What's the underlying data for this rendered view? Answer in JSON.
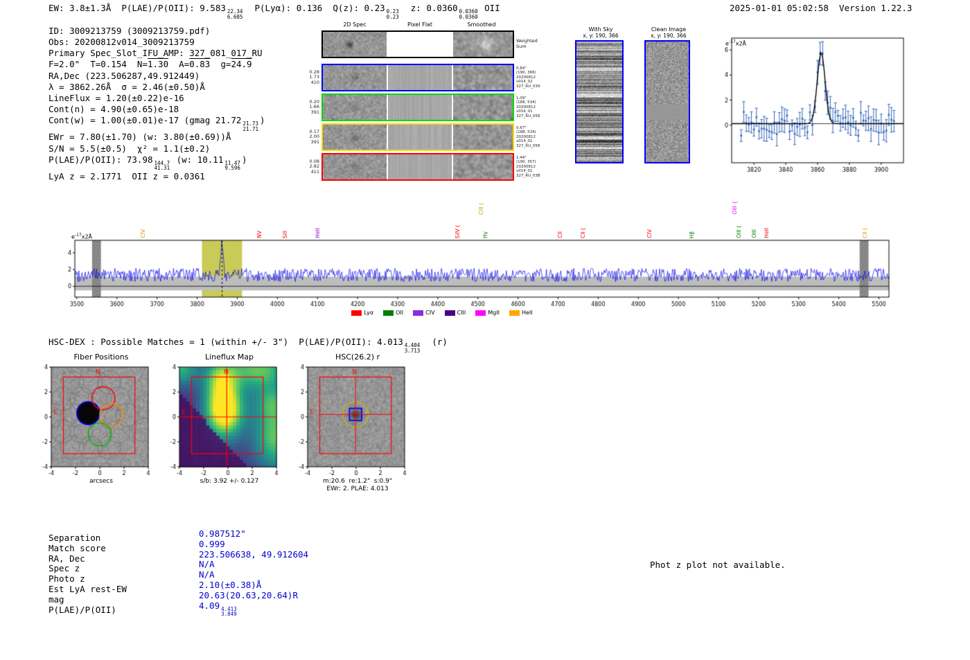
{
  "header": {
    "seg1": "EW: 3.8±1.3Å  P(LAE)/P(OII): 9.583",
    "stack1_sup": "22.34",
    "stack1_sub": "6.605",
    "seg2": "  P(Lyα): 0.136  Q(z): 0.23",
    "stack2_sup": "0.23",
    "stack2_sub": "0.23",
    "seg3": "  z: 0.0360",
    "stack3_sup": "0.0360",
    "stack3_sub": "0.0360",
    "seg4": " OII",
    "right": "2025-01-01 05:02:58  Version 1.22.3"
  },
  "info": {
    "l1": "ID: 3009213759 (3009213759.pdf)",
    "l2": "Obs: 20200812v014_3009213759",
    "l3": "Primary Spec_Slot_IFU_AMP: 327_081_017_RU",
    "l4a": "F=2.0\"  T=0.154  N=",
    "l4o1": "1.30",
    "l4b": "  A=",
    "l4o2": "0.83",
    "l4c": "  g=",
    "l4o3": "24.9",
    "l5": "RA,Dec (223.506287,49.912449)",
    "l6": "λ = 3862.26Å  σ = 2.46(±0.50)Å",
    "l7": "LineFlux = 1.20(±0.22)e-16",
    "l8": "Cont(n) = 4.90(±0.65)e-18",
    "l9a": "Cont(w) = 1.00(±0.01)e-17 (gmag 21.72",
    "l9sup": "21.73",
    "l9sub": "21.71",
    "l9b": ")",
    "l10": "EWr = 7.80(±1.70) (w: 3.80(±0.69))Å",
    "l11": "S/N = 5.5(±0.5)  χ² = 1.1(±0.2)",
    "l12a": "P(LAE)/P(OII): 73.98",
    "l12sup1": "144.7",
    "l12sub1": "41.31",
    "l12b": " (w: 10.11",
    "l12sup2": "11.47",
    "l12sub2": "9.596",
    "l12c": ")",
    "l13": "LyA z = 2.1771  OII z = 0.0361"
  },
  "spec2d": {
    "col_headers": [
      "2D Spec",
      "Pixel Flat",
      "Smoothed"
    ],
    "rows": [
      {
        "left": [],
        "right": [
          "Weighted",
          "Sum"
        ],
        "border": "#000000"
      },
      {
        "left": [
          "0.28",
          "1.73",
          "410"
        ],
        "right": [
          "0.84\"",
          "(190, 366)",
          "20200812",
          "v014_02",
          "327_RU_039"
        ],
        "border": "#0000ff"
      },
      {
        "left": [
          "0.20",
          "1.66",
          "391"
        ],
        "right": [
          "1.09\"",
          "(188, 534)",
          "20200812",
          "v014_01",
          "327_RU_058"
        ],
        "border": "#00dd00"
      },
      {
        "left": [
          "0.17",
          "2.00",
          "391"
        ],
        "right": [
          "0.67\"",
          "(188, 534)",
          "20200812",
          "v014_01",
          "327_RU_058"
        ],
        "border": "#ffd700"
      },
      {
        "left": [
          "0.08",
          "2.82",
          "411"
        ],
        "right": [
          "1.44\"",
          "(190, 357)",
          "20200812",
          "v014_01",
          "327_RU_03B"
        ],
        "border": "#ff0000"
      }
    ]
  },
  "sky_panels": {
    "with_sky": {
      "title": "With Sky",
      "subtitle": "x, y: 190, 366"
    },
    "clean": {
      "title": "Clean Image",
      "subtitle": "x, y: 190, 366"
    }
  },
  "hsc_line": {
    "prefix": "HSC-DEX : Possible Matches = 1 (within +/- 3\")  P(LAE)/P(OII): 4.013",
    "sup": "4.404",
    "sub": "3.713",
    "suffix": "  (r)"
  },
  "cutout_widgets": {
    "fiber": {
      "title": "Fiber Positions",
      "xlabel": "arcsecs"
    },
    "lineflux": {
      "title": "Lineflux Map",
      "caption": "s/b: 3.92 +/- 0.127"
    },
    "hsc": {
      "title": "HSC(26.2) r",
      "caption1": "m:20.6  re:1.2\"  s:0.9\"",
      "caption2": "EWr: 2. PLAE: 4.013"
    }
  },
  "match_table": {
    "rows": [
      {
        "label": "Separation",
        "value": "0.987512\""
      },
      {
        "label": "Match score",
        "value": "0.999"
      },
      {
        "label": "RA, Dec",
        "value": "223.506638, 49.912604"
      },
      {
        "label": "Spec z",
        "value": "N/A"
      },
      {
        "label": "Photo z",
        "value": "N/A"
      },
      {
        "label": "Est LyA rest-EW",
        "value": "2.10(±0.38)Å"
      },
      {
        "label": "mag",
        "value": "20.63(20.63,20.64)R"
      },
      {
        "label": "P(LAE)/P(OII)",
        "value": "4.09",
        "sup": "4.413",
        "sub": "3.849"
      }
    ]
  },
  "photz_note": "Phot z plot not available.",
  "chart_data": [
    {
      "id": "line_fit",
      "type": "scatter",
      "title": "",
      "unit_label": {
        "prefix": "e",
        "exp": "-17",
        "suffix": "x2Å"
      },
      "xlim": [
        3806,
        3914
      ],
      "x_ticks": [
        3820,
        3840,
        3860,
        3880,
        3900
      ],
      "ylim": [
        -3.0,
        6.95
      ],
      "y_ticks": [
        0,
        2,
        4,
        6
      ],
      "fit": {
        "center": 3862.26,
        "sigma": 2.46,
        "amplitude": 5.7,
        "continuum": 0.12
      },
      "noise": {
        "amplitude": 0.75,
        "seed": 7,
        "point_step": 1.6,
        "err_mean": 0.62
      },
      "point_color": "#3366bb",
      "fit_color": "#000000"
    },
    {
      "id": "full_spectrum",
      "type": "line",
      "title": "",
      "unit_label": {
        "prefix": "e",
        "exp": "-17",
        "suffix": "x2Å"
      },
      "xlim": [
        3495,
        5525
      ],
      "x_ticks": [
        3500,
        3600,
        3700,
        3800,
        3900,
        4000,
        4100,
        4200,
        4300,
        4400,
        4500,
        4600,
        4700,
        4800,
        4900,
        5000,
        5100,
        5200,
        5300,
        5400,
        5500
      ],
      "ylim": [
        -1.3,
        5.5
      ],
      "y_ticks": [
        0,
        2,
        4
      ],
      "continuum": 1.35,
      "noise_amplitude": 0.8,
      "seed": 99,
      "emission_line": {
        "center": 3862.26,
        "amplitude": 3.8,
        "sigma": 3.0
      },
      "error_band": {
        "low": -0.5,
        "high": 1.15,
        "color": "#bdbdbd"
      },
      "highlight_band": {
        "x0": 3812,
        "x1": 3912,
        "color": "rgba(184,184,30,0.75)"
      },
      "masked_bands": [
        {
          "x0": 3538,
          "x1": 3560
        },
        {
          "x0": 5452,
          "x1": 5474
        }
      ],
      "dashed_line_x": 3862.26,
      "line_color": "#0000ee",
      "line_labels": [
        {
          "text": "CIV",
          "x": 3665,
          "color": "#e69500",
          "lvl": 0
        },
        {
          "text": "NV",
          "x": 3955,
          "color": "#ff0000",
          "lvl": 0
        },
        {
          "text": "SiII",
          "x": 4018,
          "color": "#ff0000",
          "lvl": 0
        },
        {
          "text": "HeII",
          "x": 4100,
          "color": "#9400d3",
          "lvl": 0
        },
        {
          "text": "SiIV (",
          "x": 4448,
          "color": "#ff0000",
          "lvl": 0
        },
        {
          "text": "CIII (",
          "x": 4508,
          "color": "#c8a000",
          "lvl": 1
        },
        {
          "text": "Hγ",
          "x": 4518,
          "color": "#008000",
          "lvl": 0
        },
        {
          "text": "CII",
          "x": 4705,
          "color": "#ff0000",
          "lvl": 0
        },
        {
          "text": "CII (",
          "x": 4762,
          "color": "#ff0000",
          "lvl": 0
        },
        {
          "text": "CIV",
          "x": 4928,
          "color": "#ff0000",
          "lvl": 0
        },
        {
          "text": "Hβ",
          "x": 5032,
          "color": "#008000",
          "lvl": 0
        },
        {
          "text": "OIII {",
          "x": 5140,
          "color": "#ff00ff",
          "lvl": 1
        },
        {
          "text": "OIII (",
          "x": 5150,
          "color": "#008000",
          "lvl": 0
        },
        {
          "text": "OIII",
          "x": 5188,
          "color": "#008000",
          "lvl": 0
        },
        {
          "text": "HeII",
          "x": 5220,
          "color": "#ff0000",
          "lvl": 0
        },
        {
          "text": "CII (",
          "x": 5465,
          "color": "#e69500",
          "lvl": 0
        }
      ],
      "legend": [
        {
          "label": "Lyα",
          "color": "#ff0000"
        },
        {
          "label": "OII",
          "color": "#008000"
        },
        {
          "label": "CIV",
          "color": "#8a2be2"
        },
        {
          "label": "CIII",
          "color": "#4b0082"
        },
        {
          "label": "MgII",
          "color": "#ff00ff"
        },
        {
          "label": "HeII",
          "color": "#ffa500"
        }
      ]
    },
    {
      "id": "cutouts",
      "type": "image",
      "axis_range": [
        -4,
        4
      ],
      "ticks": [
        -4,
        -2,
        0,
        2,
        4
      ],
      "compass": {
        "n": "N",
        "e": "E"
      },
      "square": {
        "x0": -3.0,
        "y0": -2.95,
        "x1": 2.9,
        "y1": 3.2,
        "color": "#ff0000"
      },
      "fiber": {
        "circle_radius": 0.95,
        "gray_circles": [
          [
            0.76,
            0.15
          ],
          [
            -2.26,
            0.15
          ],
          [
            0.01,
            1.46
          ],
          [
            -1.51,
            1.46
          ],
          [
            0.01,
            -1.16
          ],
          [
            -1.51,
            -1.16
          ],
          [
            2.27,
            0.15
          ],
          [
            -3.77,
            0.15
          ],
          [
            1.52,
            1.46
          ],
          [
            -3.02,
            1.46
          ],
          [
            1.52,
            -1.16
          ],
          [
            -3.02,
            -1.16
          ],
          [
            0.76,
            2.77
          ],
          [
            -0.75,
            2.77
          ],
          [
            -2.26,
            2.77
          ],
          [
            0.76,
            -2.47
          ],
          [
            -0.75,
            -2.47
          ],
          [
            -2.26,
            -2.47
          ],
          [
            3.78,
            0.85
          ],
          [
            3.6,
            -1.05
          ]
        ],
        "colored_circles": [
          {
            "x": -0.95,
            "y": 0.3,
            "color": "#0000ff",
            "fill": "#05050a"
          },
          {
            "x": 0.3,
            "y": 1.5,
            "color": "#ff0000"
          },
          {
            "x": 0.95,
            "y": 0.15,
            "color": "#ff8c00"
          },
          {
            "x": 0.0,
            "y": -1.4,
            "color": "#00bb00"
          }
        ]
      },
      "lineflux": {
        "blobs": [
          {
            "x": -0.3,
            "y": 0.5,
            "sx": 1.1,
            "sy": 1.5,
            "amp": 1.05
          },
          {
            "x": -0.6,
            "y": 3.2,
            "sx": 1.0,
            "sy": 1.2,
            "amp": 0.55
          },
          {
            "x": 2.6,
            "y": 3.8,
            "sx": 1.7,
            "sy": 1.1,
            "amp": 0.6
          },
          {
            "x": 3.9,
            "y": -1.6,
            "sx": 1.3,
            "sy": 1.9,
            "amp": 0.6
          },
          {
            "x": -3.9,
            "y": 3.9,
            "sx": 1.0,
            "sy": 1.0,
            "amp": 0.5
          },
          {
            "x": 3.6,
            "y": 1.2,
            "sx": 1.0,
            "sy": 1.0,
            "amp": 0.35
          }
        ],
        "dark_edge": {
          "slope": -1.05,
          "intercept": -2.3
        }
      },
      "hsc": {
        "blob": {
          "x": -0.05,
          "y": 0.2
        },
        "yellow_circle_r": 1.05,
        "blue_square_half": 0.5
      }
    }
  ]
}
